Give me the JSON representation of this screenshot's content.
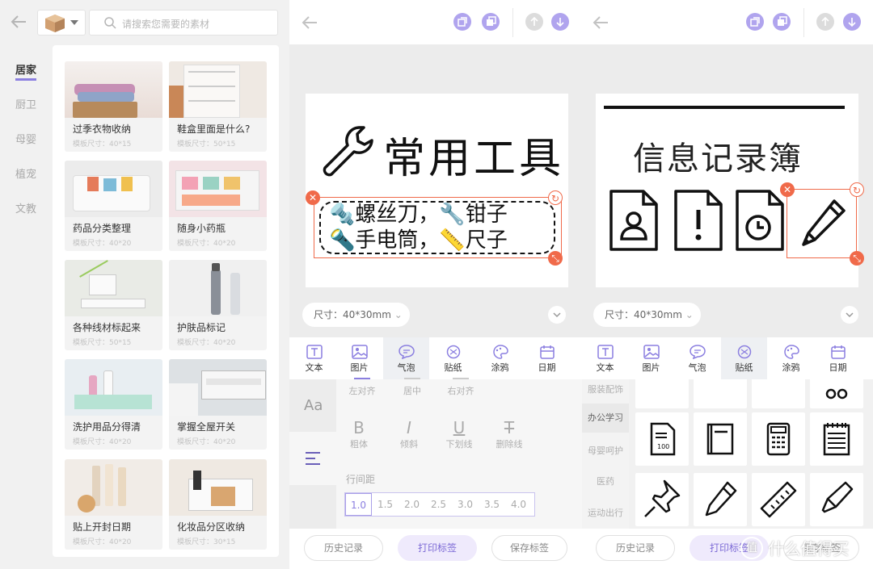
{
  "colors": {
    "accent": "#8b7fe0",
    "selection": "#f06a4a"
  },
  "left": {
    "search_placeholder": "请搜索您需要的素材",
    "categories": [
      "居家",
      "厨卫",
      "母婴",
      "植宠",
      "文教"
    ],
    "cards": [
      {
        "title": "过季衣物收纳",
        "size": "模板尺寸：40*15"
      },
      {
        "title": "鞋盒里面是什么?",
        "size": "模板尺寸：50*15"
      },
      {
        "title": "药品分类整理",
        "size": "模板尺寸：40*20"
      },
      {
        "title": "随身小药瓶",
        "size": "模板尺寸：40*20"
      },
      {
        "title": "各种线材标起来",
        "size": "模板尺寸：50*15"
      },
      {
        "title": "护肤品标记",
        "size": "模板尺寸：40*20"
      },
      {
        "title": "洗护用品分得清",
        "size": "模板尺寸：40*20"
      },
      {
        "title": "掌握全屋开关",
        "size": "模板尺寸：40*20"
      },
      {
        "title": "贴上开封日期",
        "size": "模板尺寸：40*20"
      },
      {
        "title": "化妆品分区收纳",
        "size": "模板尺寸：30*15"
      }
    ]
  },
  "mid": {
    "label_title": "常用工具",
    "bubble_line1": "螺丝刀，",
    "bubble_line1b": "钳子",
    "bubble_line2": "手电筒，",
    "bubble_line2b": "尺子",
    "size": "尺寸：40*30mm",
    "tools": [
      "文本",
      "图片",
      "气泡",
      "贴纸",
      "涂鸦",
      "日期"
    ],
    "align": [
      "左对齐",
      "居中",
      "右对齐"
    ],
    "styles": [
      {
        "glyph": "B",
        "label": "粗体"
      },
      {
        "glyph": "I",
        "label": "倾斜"
      },
      {
        "glyph": "U",
        "label": "下划线"
      },
      {
        "glyph": "T",
        "label": "删除线"
      }
    ],
    "line_spacing_label": "行间距",
    "line_spacing": [
      "1.0",
      "1.5",
      "2.0",
      "2.5",
      "3.0",
      "3.5",
      "4.0"
    ],
    "font_icon": "Aa",
    "buttons": [
      "历史记录",
      "打印标签",
      "保存标签"
    ]
  },
  "right": {
    "label_title": "信息记录簿",
    "size": "尺寸：40*30mm",
    "tools": [
      "文本",
      "图片",
      "气泡",
      "贴纸",
      "涂鸦",
      "日期"
    ],
    "sticker_cats": [
      "服装配饰",
      "办公学习",
      "母婴呵护",
      "医药",
      "运动出行"
    ],
    "buttons": [
      "历史记录",
      "打印标签",
      "保存标签"
    ],
    "watermark": "什么值得买"
  }
}
